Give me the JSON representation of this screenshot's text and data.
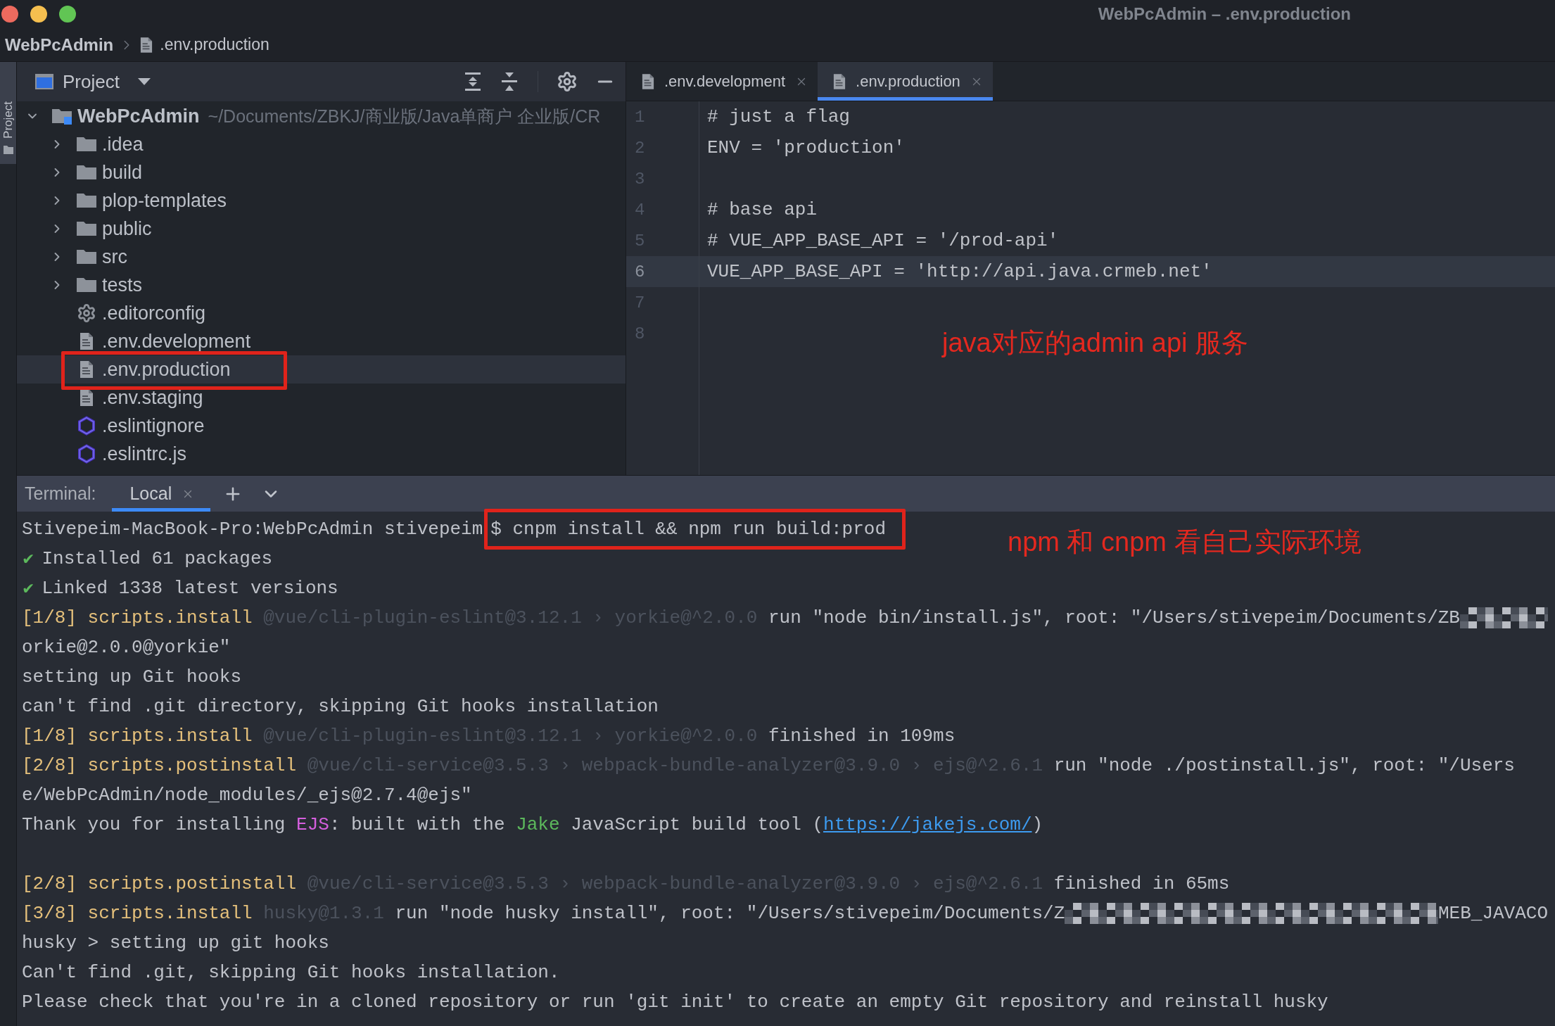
{
  "window": {
    "title": "WebPcAdmin – .env.production"
  },
  "breadcrumb": [
    {
      "kind": "project",
      "label": "WebPcAdmin"
    },
    {
      "kind": "file",
      "label": ".env.production"
    }
  ],
  "tool_stripe": {
    "label": "Project",
    "selected": true
  },
  "project_panel": {
    "title": "Project",
    "tree": [
      {
        "kind": "module",
        "label": "WebPcAdmin",
        "path": "~/Documents/ZBKJ/商业版/Java单商户 企业版/CR",
        "expanded": true,
        "selected": false,
        "annotated": false,
        "children": [
          {
            "kind": "folder",
            "label": ".idea",
            "expanded": false,
            "selected": false,
            "annotated": false
          },
          {
            "kind": "folder",
            "label": "build",
            "expanded": false,
            "selected": false,
            "annotated": false
          },
          {
            "kind": "folder",
            "label": "plop-templates",
            "expanded": false,
            "selected": false,
            "annotated": false
          },
          {
            "kind": "folder",
            "label": "public",
            "expanded": false,
            "selected": false,
            "annotated": false
          },
          {
            "kind": "folder",
            "label": "src",
            "expanded": false,
            "selected": false,
            "annotated": false
          },
          {
            "kind": "folder",
            "label": "tests",
            "expanded": false,
            "selected": false,
            "annotated": false
          },
          {
            "kind": "config",
            "label": ".editorconfig",
            "selected": false,
            "annotated": false
          },
          {
            "kind": "env",
            "label": ".env.development",
            "selected": false,
            "annotated": false
          },
          {
            "kind": "env",
            "label": ".env.production",
            "selected": true,
            "annotated": true
          },
          {
            "kind": "env",
            "label": ".env.staging",
            "selected": false,
            "annotated": false
          },
          {
            "kind": "eslint",
            "label": ".eslintignore",
            "selected": false,
            "annotated": false
          },
          {
            "kind": "eslint",
            "label": ".eslintrc.js",
            "selected": false,
            "annotated": false
          }
        ]
      }
    ]
  },
  "editor": {
    "tabs": [
      {
        "label": ".env.development",
        "selected": false
      },
      {
        "label": ".env.production",
        "selected": true
      }
    ],
    "lines": [
      {
        "number": "1",
        "text": "# just a flag",
        "current": false
      },
      {
        "number": "2",
        "text": "ENV = 'production'",
        "current": false
      },
      {
        "number": "3",
        "current": false
      },
      {
        "number": "4",
        "text": "# base api",
        "current": false
      },
      {
        "number": "5",
        "text": "# VUE_APP_BASE_API = '/prod-api'",
        "current": false
      },
      {
        "number": "6",
        "text": "VUE_APP_BASE_API = 'http://api.java.crmeb.net'",
        "current": true
      },
      {
        "number": "7",
        "current": false
      },
      {
        "number": "8",
        "current": false
      }
    ],
    "note": "java对应的admin api 服务"
  },
  "terminal": {
    "title": "Terminal:",
    "tabs": [
      {
        "label": "Local",
        "selected": true
      }
    ],
    "lines": [
      {
        "kind": "output",
        "segments": [
          {
            "kind": "text",
            "text": "Stivepeim-MacBook-Pro:WebPcAdmin stivepeim"
          },
          {
            "kind": "framed",
            "text": "$ cnpm install && npm run build:prod"
          }
        ]
      },
      {
        "kind": "output",
        "segments": [
          {
            "kind": "check",
            "text": "✔"
          },
          {
            "kind": "text",
            "text": "Installed 61 packages"
          }
        ]
      },
      {
        "kind": "output",
        "segments": [
          {
            "kind": "check",
            "text": "✔"
          },
          {
            "kind": "text",
            "text": "Linked 1338 latest versions"
          }
        ]
      },
      {
        "kind": "output",
        "segments": [
          {
            "kind": "step",
            "text": "[1/8] scripts.install "
          },
          {
            "kind": "dim",
            "text": "@vue/cli-plugin-eslint@3.12.1 › yorkie@^2.0.0 "
          },
          {
            "kind": "text",
            "text": "run \"node bin/install.js\", root: \"/Users/stivepeim/Documents/ZB"
          },
          {
            "kind": "redacted"
          }
        ]
      },
      {
        "kind": "output",
        "segments": [
          {
            "kind": "text",
            "text": "orkie@2.0.0@yorkie\""
          }
        ]
      },
      {
        "kind": "output",
        "segments": [
          {
            "kind": "text",
            "text": "setting up Git hooks"
          }
        ]
      },
      {
        "kind": "output",
        "segments": [
          {
            "kind": "text",
            "text": "can't find .git directory, skipping Git hooks installation"
          }
        ]
      },
      {
        "kind": "output",
        "segments": [
          {
            "kind": "step",
            "text": "[1/8] scripts.install "
          },
          {
            "kind": "dim",
            "text": "@vue/cli-plugin-eslint@3.12.1 › yorkie@^2.0.0 "
          },
          {
            "kind": "text",
            "text": "finished in 109ms"
          }
        ]
      },
      {
        "kind": "output",
        "segments": [
          {
            "kind": "step",
            "text": "[2/8] scripts.postinstall "
          },
          {
            "kind": "dim",
            "text": "@vue/cli-service@3.5.3 › webpack-bundle-analyzer@3.9.0 › ejs@^2.6.1 "
          },
          {
            "kind": "text",
            "text": "run \"node ./postinstall.js\", root: \"/Users"
          }
        ]
      },
      {
        "kind": "output",
        "segments": [
          {
            "kind": "text",
            "text": "e/WebPcAdmin/node_modules/_ejs@2.7.4@ejs\""
          }
        ]
      },
      {
        "kind": "output",
        "segments": [
          {
            "kind": "text",
            "text": "Thank you for installing "
          },
          {
            "kind": "magenta",
            "text": "EJS"
          },
          {
            "kind": "text",
            "text": ": built with the "
          },
          {
            "kind": "green",
            "text": "Jake"
          },
          {
            "kind": "text",
            "text": " JavaScript build tool ("
          },
          {
            "kind": "link",
            "text": "https://jakejs.com/"
          },
          {
            "kind": "text",
            "text": ")"
          }
        ]
      },
      {
        "kind": "blank"
      },
      {
        "kind": "output",
        "segments": [
          {
            "kind": "step",
            "text": "[2/8] scripts.postinstall "
          },
          {
            "kind": "dim",
            "text": "@vue/cli-service@3.5.3 › webpack-bundle-analyzer@3.9.0 › ejs@^2.6.1 "
          },
          {
            "kind": "text",
            "text": "finished in 65ms"
          }
        ]
      },
      {
        "kind": "output",
        "segments": [
          {
            "kind": "step",
            "text": "[3/8] scripts.install "
          },
          {
            "kind": "dim",
            "text": "husky@1.3.1 "
          },
          {
            "kind": "text",
            "text": "run \"node husky install\", root: \"/Users/stivepeim/Documents/Z"
          },
          {
            "kind": "redacted"
          },
          {
            "kind": "text",
            "text": "MEB_JAVACO"
          }
        ]
      },
      {
        "kind": "output",
        "segments": [
          {
            "kind": "text",
            "text": "husky > setting up git hooks"
          }
        ]
      },
      {
        "kind": "output",
        "segments": [
          {
            "kind": "text",
            "text": "Can't find .git, skipping Git hooks installation."
          }
        ]
      },
      {
        "kind": "output",
        "segments": [
          {
            "kind": "text",
            "text": "Please check that you're in a cloned repository or run 'git init' to create an empty Git repository and reinstall husky"
          }
        ]
      }
    ],
    "note": "npm 和 cnpm 看自己实际环境"
  }
}
